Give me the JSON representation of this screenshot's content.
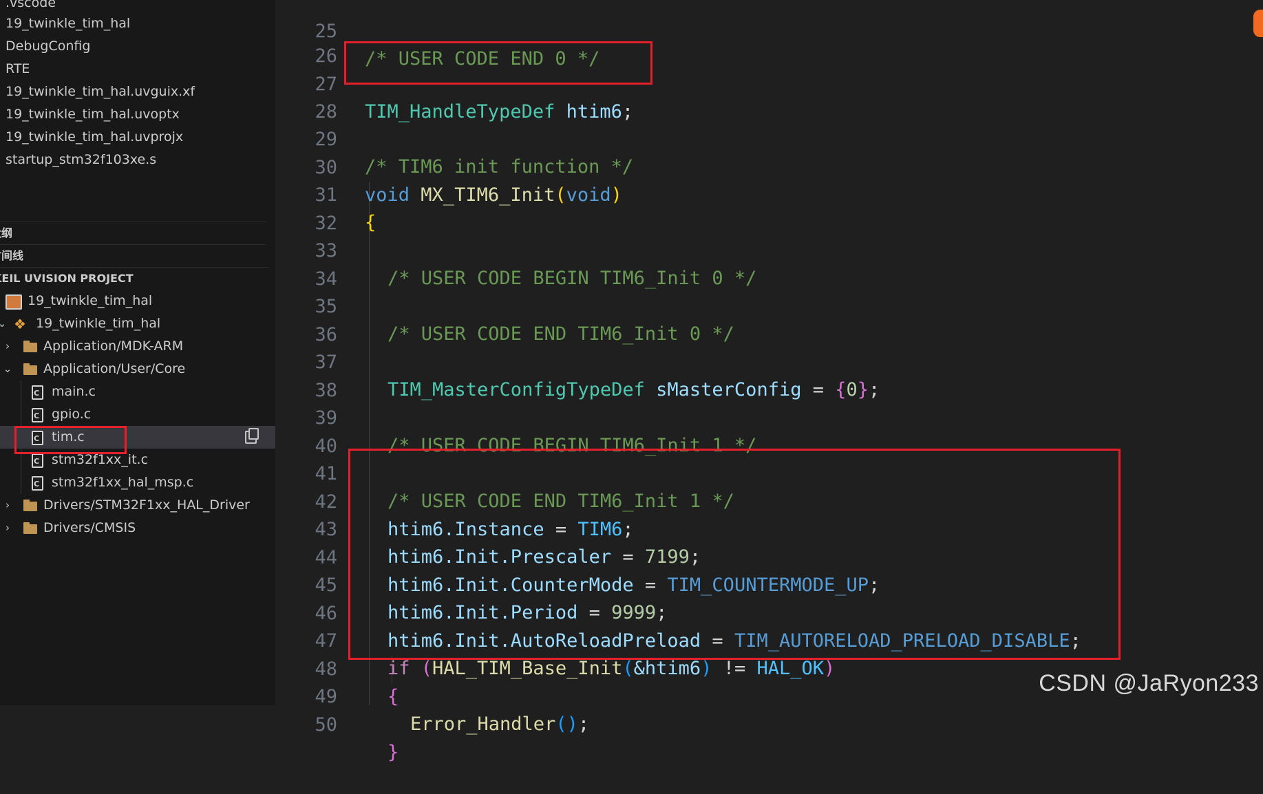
{
  "explorer": {
    "files": [
      ".vscode",
      "19_twinkle_tim_hal",
      "DebugConfig",
      "RTE",
      "19_twinkle_tim_hal.uvguix.xf",
      "19_twinkle_tim_hal.uvoptx",
      "19_twinkle_tim_hal.uvprojx",
      "startup_stm32f103xe.s"
    ]
  },
  "sections": {
    "outline": "大纲",
    "timeline": "时间线",
    "keil_project": "KEIL UVISION PROJECT"
  },
  "project_tree": {
    "workspace": "19_twinkle_tim_hal",
    "target": "19_twinkle_tim_hal",
    "groups": {
      "mdk_arm": "Application/MDK-ARM",
      "user_core": "Application/User/Core",
      "hal_driver": "Drivers/STM32F1xx_HAL_Driver",
      "cmsis": "Drivers/CMSIS"
    },
    "files": {
      "main": "main.c",
      "gpio": "gpio.c",
      "tim": "tim.c",
      "it": "stm32f1xx_it.c",
      "msp": "stm32f1xx_hal_msp.c"
    }
  },
  "editor": {
    "line_numbers": [
      "25",
      "26",
      "27",
      "28",
      "29",
      "30",
      "31",
      "32",
      "33",
      "34",
      "35",
      "36",
      "37",
      "38",
      "39",
      "40",
      "41",
      "42",
      "43",
      "44",
      "45",
      "46",
      "47",
      "48",
      "49",
      "50"
    ],
    "code": {
      "l25_comment": "/* USER CODE END 0 */",
      "l27_type": "TIM_HandleTypeDef",
      "l27_var": "htim6",
      "l27_semi": ";",
      "l29_comment": "/* TIM6 init function */",
      "l30_void1": "void",
      "l30_fn": "MX_TIM6_Init",
      "l30_open": "(",
      "l30_void2": "void",
      "l30_close": ")",
      "l31_brace": "{",
      "l33_comment": "/* USER CODE BEGIN TIM6_Init 0 */",
      "l35_comment": "/* USER CODE END TIM6_Init 0 */",
      "l37_type": "TIM_MasterConfigTypeDef",
      "l37_var": "sMasterConfig",
      "l37_eq": " = ",
      "l37_open": "{",
      "l37_num": "0",
      "l37_close": "}",
      "l37_semi": ";",
      "l39_comment": "/* USER CODE BEGIN TIM6_Init 1 */",
      "l41_comment": "/* USER CODE END TIM6_Init 1 */",
      "l42_lhs": "htim6.Instance",
      "l42_eq": " = ",
      "l42_rhs": "TIM6",
      "l42_semi": ";",
      "l43_lhs": "htim6.Init.Prescaler",
      "l43_eq": " = ",
      "l43_rhs": "7199",
      "l43_semi": ";",
      "l44_lhs": "htim6.Init.CounterMode",
      "l44_eq": " = ",
      "l44_rhs": "TIM_COUNTERMODE_UP",
      "l44_semi": ";",
      "l45_lhs": "htim6.Init.Period",
      "l45_eq": " = ",
      "l45_rhs": "9999",
      "l45_semi": ";",
      "l46_lhs": "htim6.Init.AutoReloadPreload",
      "l46_eq": " = ",
      "l46_rhs": "TIM_AUTORELOAD_PRELOAD_DISABLE",
      "l46_semi": ";",
      "l47_if": "if",
      "l47_open": " (",
      "l47_fn": "HAL_TIM_Base_Init",
      "l47_open2": "(",
      "l47_arg": "&htim6",
      "l47_close2": ")",
      "l47_ne": " != ",
      "l47_const": "HAL_OK",
      "l47_close": ")",
      "l48_brace": "{",
      "l49_fn": "Error_Handler",
      "l49_parens": "()",
      "l49_semi": ";",
      "l50_brace": "}"
    }
  },
  "watermark": "CSDN @JaRyon233",
  "colors": {
    "highlight_box": "#e5202a",
    "editor_bg": "#1f1f1f",
    "sidebar_bg": "#181818"
  }
}
